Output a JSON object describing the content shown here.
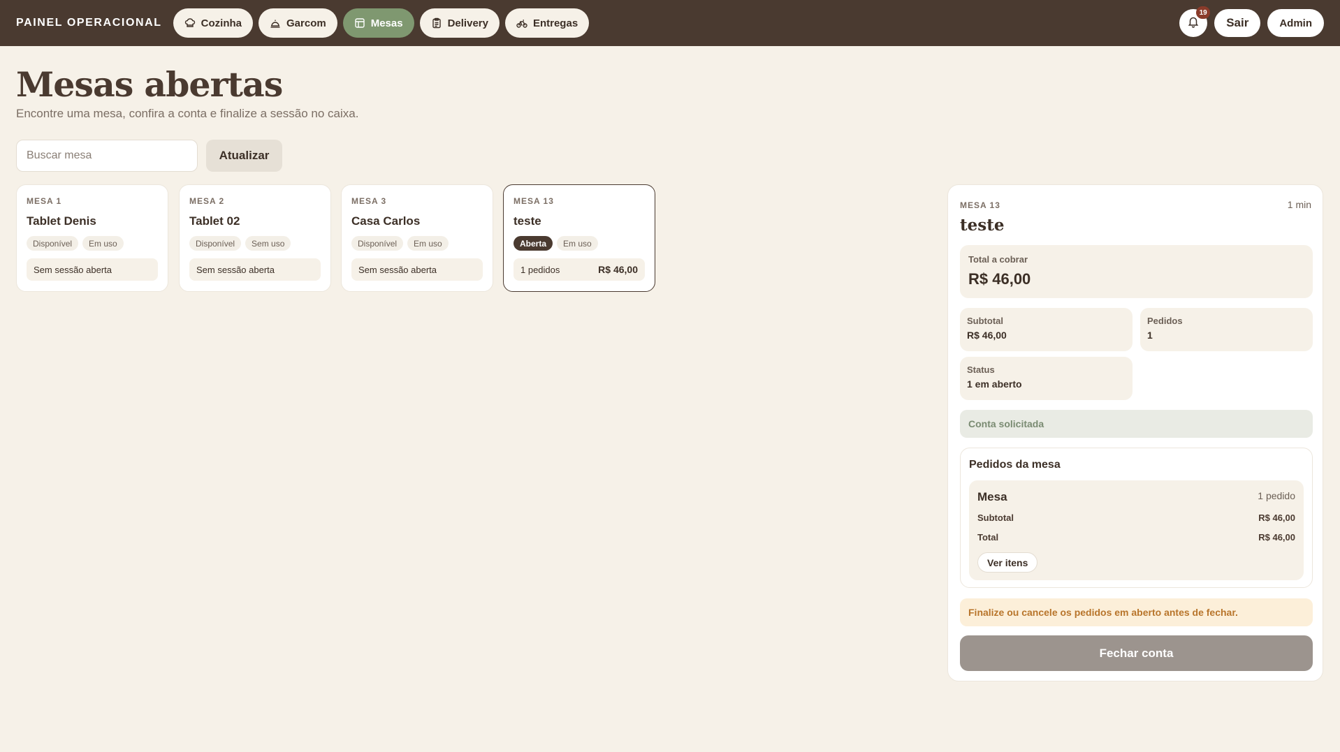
{
  "topbar": {
    "brand": "PAINEL OPERACIONAL",
    "nav": [
      {
        "label": "Cozinha",
        "icon": "chef-hat-icon",
        "active": false
      },
      {
        "label": "Garcom",
        "icon": "cloche-icon",
        "active": false
      },
      {
        "label": "Mesas",
        "icon": "table-grid-icon",
        "active": true
      },
      {
        "label": "Delivery",
        "icon": "clipboard-icon",
        "active": false
      },
      {
        "label": "Entregas",
        "icon": "bike-icon",
        "active": false
      }
    ],
    "notifications_count": "19",
    "logout_label": "Sair",
    "user_label": "Admin"
  },
  "header": {
    "title": "Mesas abertas",
    "subtitle": "Encontre uma mesa, confira a conta e finalize a sessão no caixa."
  },
  "search": {
    "placeholder": "Buscar mesa",
    "value": "",
    "refresh_label": "Atualizar"
  },
  "tables": [
    {
      "label": "MESA 1",
      "name": "Tablet Denis",
      "tag1": "Disponível",
      "tag2": "Em uso",
      "foot_left": "Sem sessão aberta",
      "foot_right": ""
    },
    {
      "label": "MESA 2",
      "name": "Tablet 02",
      "tag1": "Disponível",
      "tag2": "Sem uso",
      "foot_left": "Sem sessão aberta",
      "foot_right": ""
    },
    {
      "label": "MESA 3",
      "name": "Casa Carlos",
      "tag1": "Disponível",
      "tag2": "Em uso",
      "foot_left": "Sem sessão aberta",
      "foot_right": ""
    },
    {
      "label": "MESA 13",
      "name": "teste",
      "tag1": "Aberta",
      "tag2": "Em uso",
      "foot_left": "1 pedidos",
      "foot_right": "R$ 46,00"
    }
  ],
  "detail": {
    "label": "MESA 13",
    "elapsed": "1 min",
    "name": "teste",
    "total_label": "Total a cobrar",
    "total_value": "R$ 46,00",
    "subtotal_label": "Subtotal",
    "subtotal_value": "R$ 46,00",
    "orders_label": "Pedidos",
    "orders_value": "1",
    "status_label": "Status",
    "status_value": "1 em aberto",
    "request_text": "Conta solicitada",
    "orders_section_title": "Pedidos da mesa",
    "order": {
      "name": "Mesa",
      "count": "1 pedido",
      "subtotal_label": "Subtotal",
      "subtotal_value": "R$ 46,00",
      "total_label": "Total",
      "total_value": "R$ 46,00",
      "view_items_label": "Ver itens"
    },
    "warning": "Finalize ou cancele os pedidos em aberto antes de fechar.",
    "close_label": "Fechar conta"
  },
  "colors": {
    "topbar": "#4a3a30",
    "background": "#f6f1e8",
    "active_nav": "#7f9870",
    "badge": "#8a3b2a",
    "warning_bg": "#fcefd9",
    "warning_text": "#b8752b",
    "close_button": "#9c948e"
  }
}
